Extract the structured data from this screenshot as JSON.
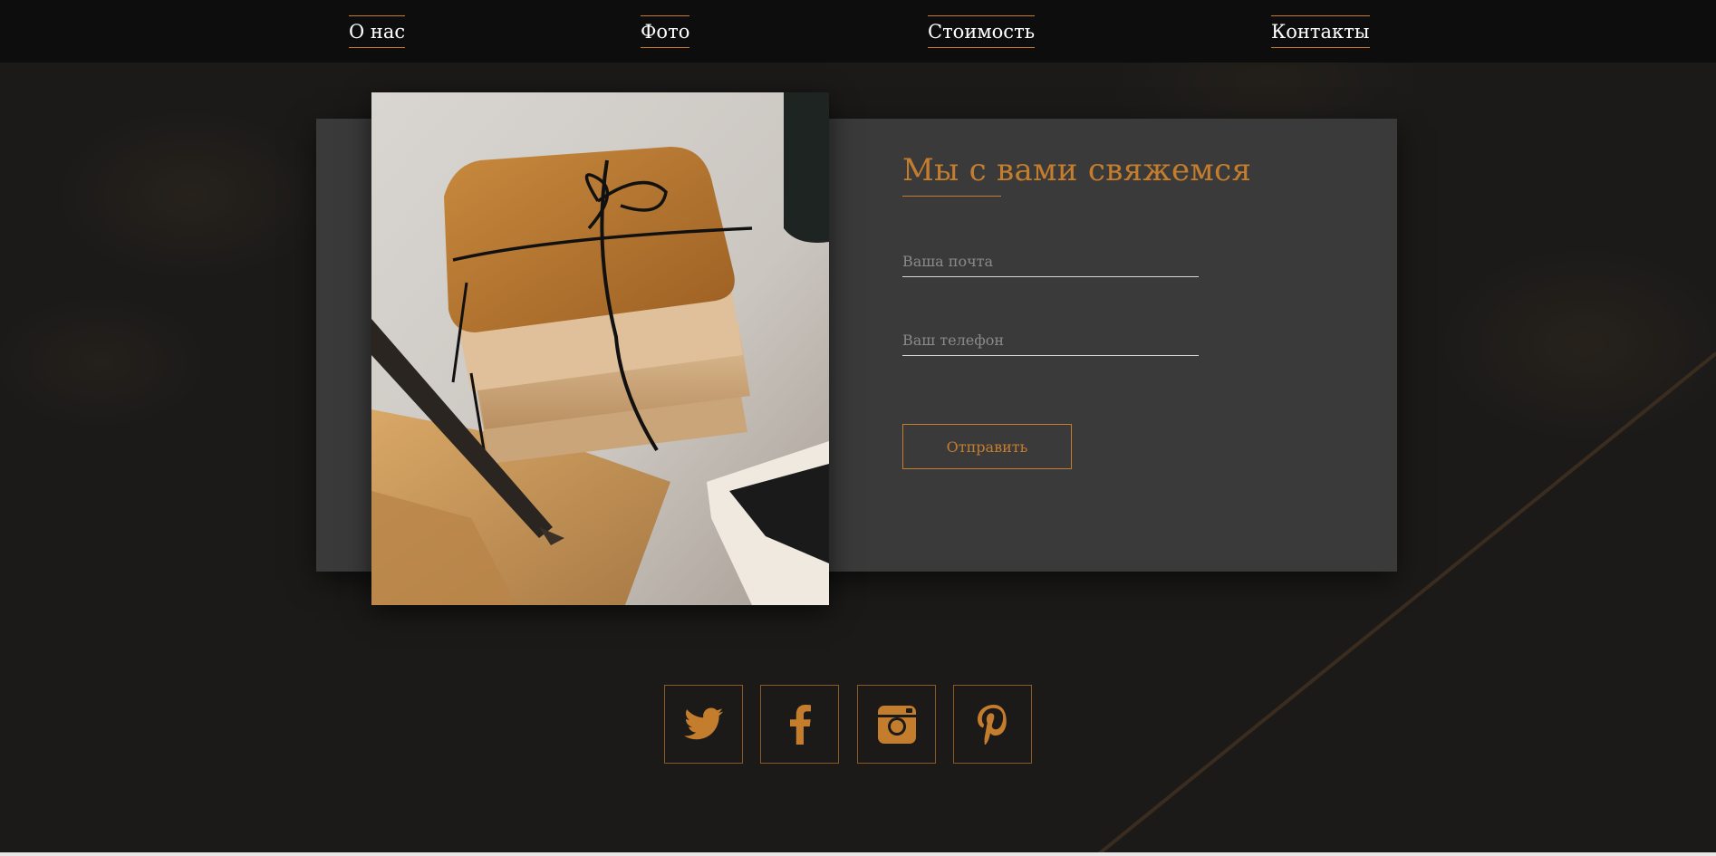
{
  "nav": {
    "items": [
      {
        "label": "О нас"
      },
      {
        "label": "Фото"
      },
      {
        "label": "Стоимость"
      },
      {
        "label": "Контакты"
      }
    ]
  },
  "contact_form": {
    "title": "Мы с вами свяжемся",
    "email": {
      "placeholder": "Ваша почта",
      "value": ""
    },
    "phone": {
      "placeholder": "Ваш телефон",
      "value": ""
    },
    "submit_label": "Отправить"
  },
  "photo": {
    "subject": "stack of old tied letters with fountain pen"
  },
  "social": [
    {
      "icon": "twitter-icon"
    },
    {
      "icon": "facebook-icon"
    },
    {
      "icon": "instagram-icon"
    },
    {
      "icon": "pinterest-icon"
    }
  ],
  "colors": {
    "accent": "#c47d2d",
    "background": "#1b1a19",
    "nav_background": "#0d0d0d",
    "card_background": "#3a3a3a",
    "text": "#ffffff"
  }
}
